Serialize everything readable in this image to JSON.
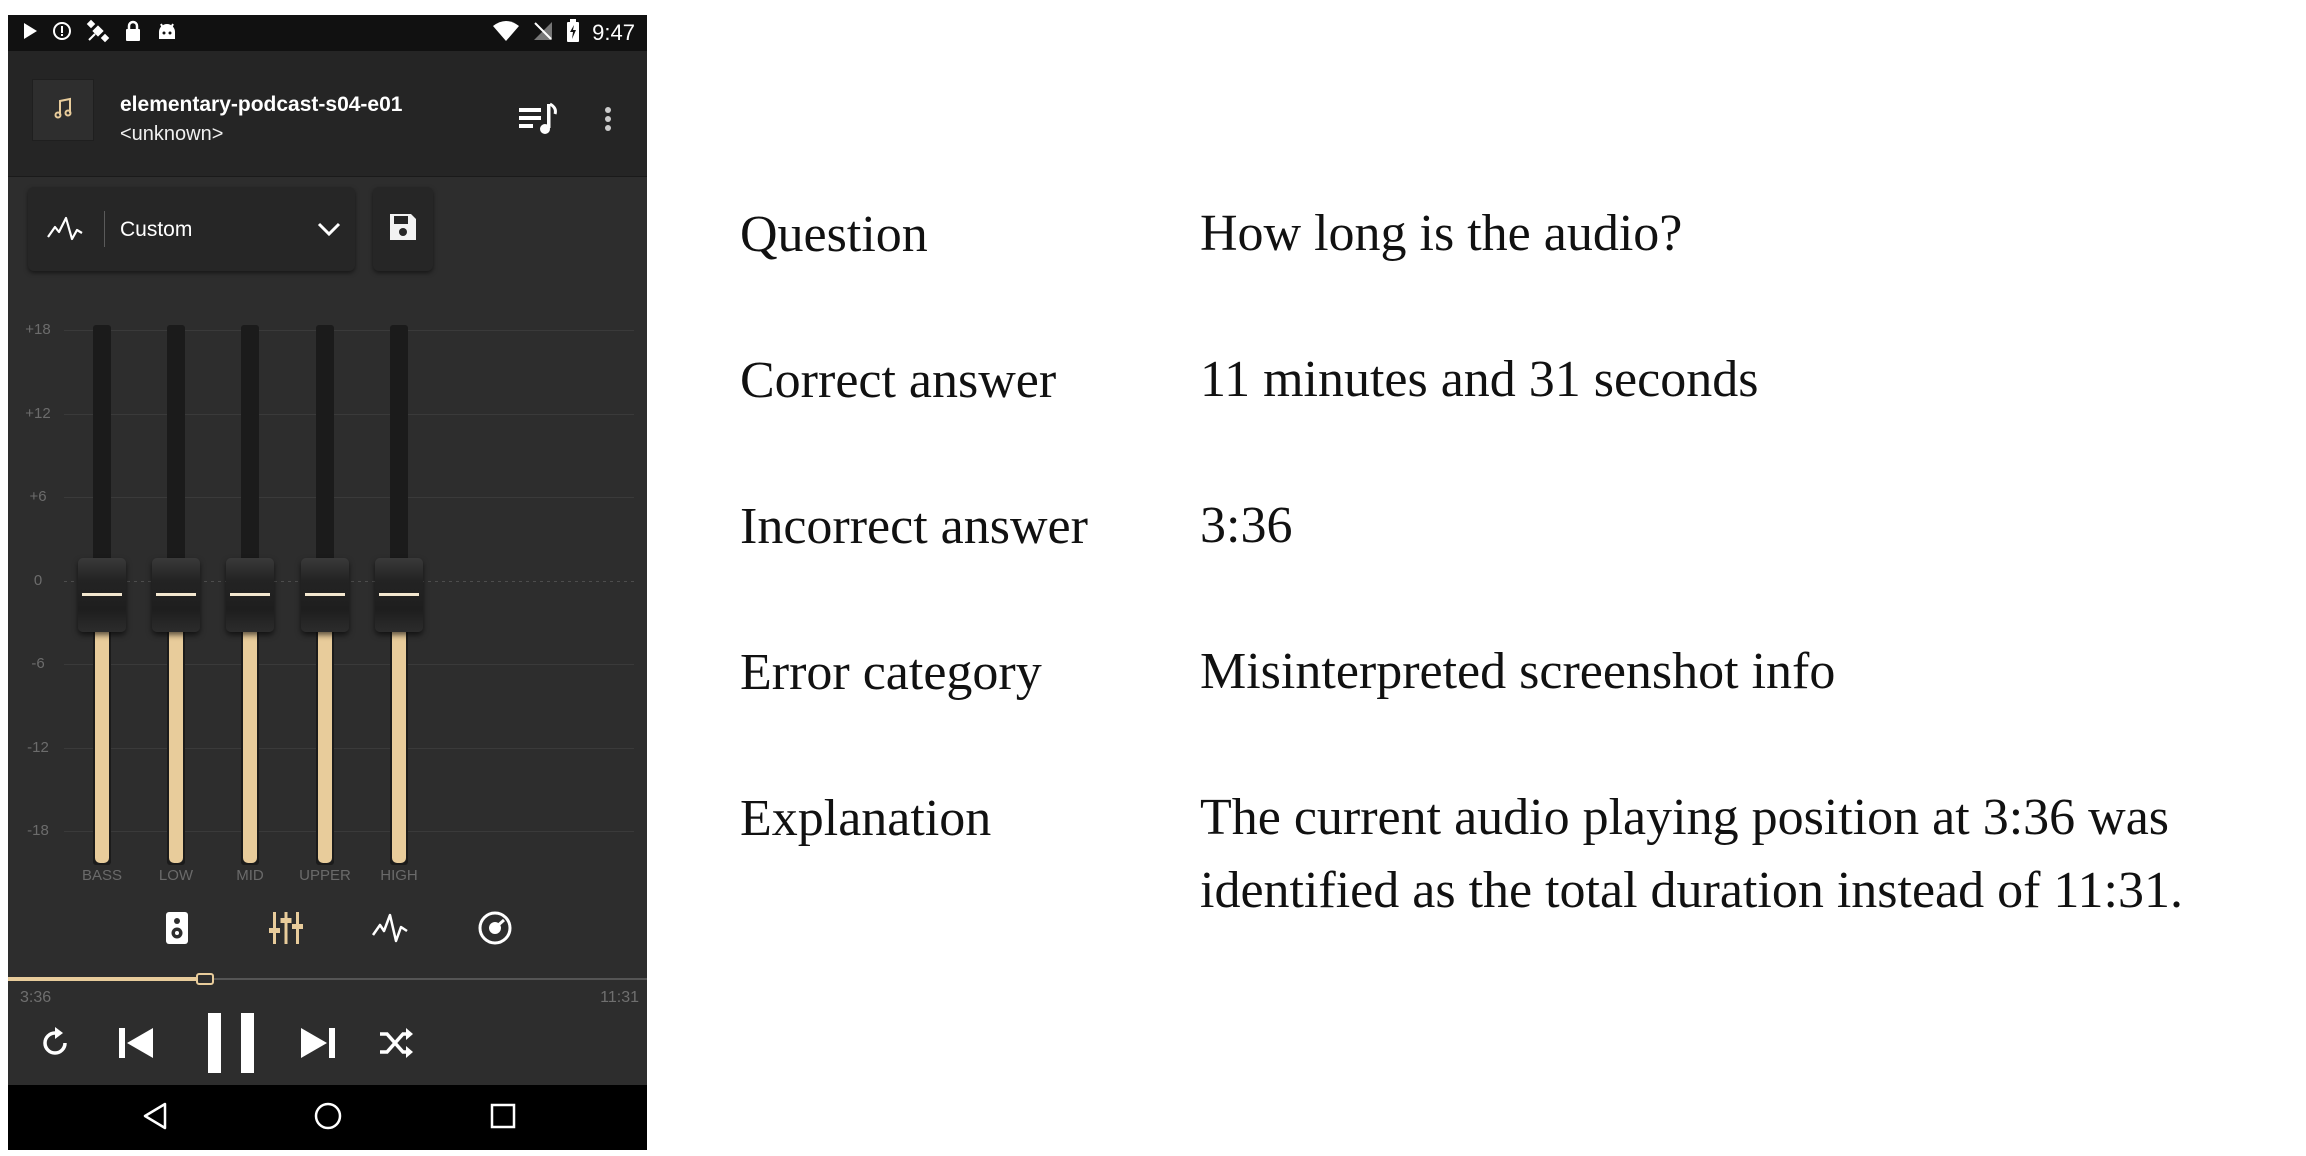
{
  "status_bar": {
    "time": "9:47",
    "icons_left": [
      "play-icon",
      "alert-circle-icon",
      "satellite-icon",
      "lock-icon",
      "android-icon"
    ],
    "icons_right": [
      "wifi-icon",
      "no-signal-icon",
      "battery-charging-icon"
    ]
  },
  "now_playing": {
    "title": "elementary-podcast-s04-e01",
    "artist": "<unknown>",
    "album_art_icon": "music-note-icon"
  },
  "equalizer": {
    "preset_label": "Custom",
    "db_scale": [
      "+18",
      "+12",
      "+6",
      "0",
      "-6",
      "-12",
      "-18"
    ],
    "bands": [
      {
        "label": "BASS",
        "gain_db": 0
      },
      {
        "label": "LOW",
        "gain_db": 0
      },
      {
        "label": "MID",
        "gain_db": 0
      },
      {
        "label": "UPPER",
        "gain_db": 0
      },
      {
        "label": "HIGH",
        "gain_db": 0
      }
    ]
  },
  "bottom_tabs": [
    "speaker-icon",
    "equalizer-sliders-icon",
    "waveform-icon",
    "dial-icon"
  ],
  "playback": {
    "current_time": "3:36",
    "total_time": "11:31",
    "progress_fraction": 0.3126
  },
  "accent_color": "#e8cc9b",
  "qa": {
    "question_key": "Question",
    "question_value": "How long is the audio?",
    "correct_key": "Correct answer",
    "correct_value": "11 minutes and 31 seconds",
    "incorrect_key": "Incorrect answer",
    "incorrect_value": "3:36",
    "error_key": "Error category",
    "error_value": "Misinterpreted screenshot info",
    "explanation_key": "Explanation",
    "explanation_line1": "The current audio playing position at 3:36 was",
    "explanation_line2": "identified as the total duration instead of 11:31."
  }
}
